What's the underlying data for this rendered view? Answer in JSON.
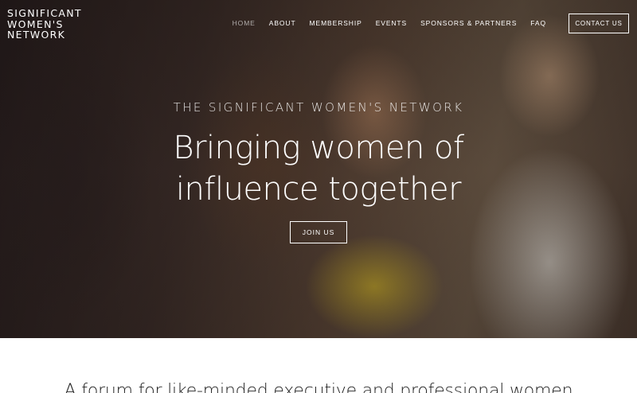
{
  "logo": {
    "lines": [
      "SIGNIFICANT",
      "WOMEN'S",
      "NETWORK"
    ]
  },
  "nav": {
    "items": [
      {
        "label": "Home",
        "active": true
      },
      {
        "label": "About",
        "active": false
      },
      {
        "label": "Membership",
        "active": false
      },
      {
        "label": "Events",
        "active": false
      },
      {
        "label": "Sponsors & Partners",
        "active": false
      },
      {
        "label": "FAQ",
        "active": false
      }
    ],
    "contact_label": "Contact Us"
  },
  "hero": {
    "eyebrow": "THE SIGNIFICANT WOMEN'S NETWORK",
    "headline_lines": [
      "Bringing women of",
      "influence together"
    ],
    "cta_label": "Join Us",
    "image_description_icon": "photo-two-smiling-women"
  },
  "intro": {
    "text": "A forum for like-minded executive and professional women"
  }
}
